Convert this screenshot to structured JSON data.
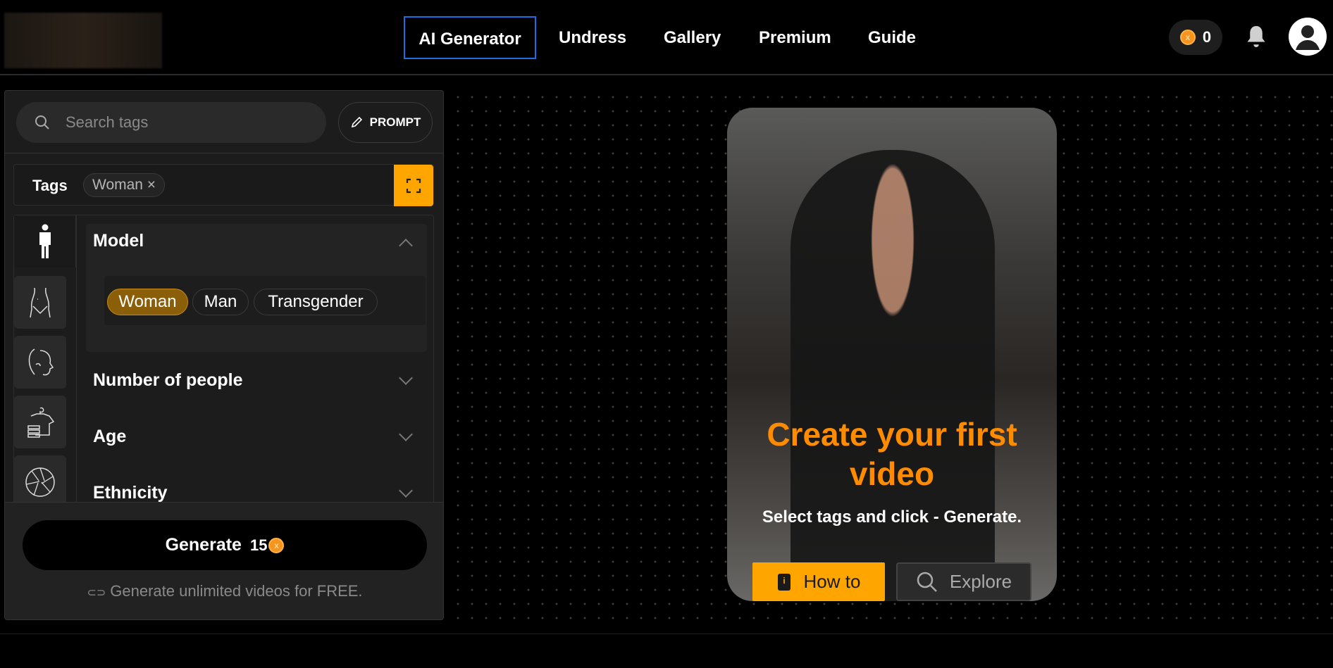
{
  "header": {
    "nav": [
      {
        "label": "AI Generator",
        "active": true
      },
      {
        "label": "Undress"
      },
      {
        "label": "Gallery"
      },
      {
        "label": "Premium"
      },
      {
        "label": "Guide"
      }
    ],
    "coins": "0",
    "icons": {
      "coin": "coin-icon",
      "bell": "bell-icon",
      "avatar": "user-avatar-icon"
    }
  },
  "panel": {
    "search": {
      "placeholder": "Search tags"
    },
    "prompt_label": "PROMPT",
    "tags_label": "Tags",
    "selected_tags": [
      {
        "label": "Woman ×"
      }
    ],
    "accent": "#ffa500",
    "sections": [
      {
        "title": "Model",
        "expanded": true,
        "options": [
          {
            "label": "Woman",
            "selected": true
          },
          {
            "label": "Man"
          },
          {
            "label": "Transgender"
          }
        ]
      },
      {
        "title": "Number of people",
        "expanded": false
      },
      {
        "title": "Age",
        "expanded": false
      },
      {
        "title": "Ethnicity",
        "expanded": false
      }
    ],
    "generate": {
      "label": "Generate",
      "cost": "15",
      "coin_symbol": "x"
    },
    "free_text": "Generate unlimited videos for FREE."
  },
  "card": {
    "title": "Create your first video",
    "subtitle": "Select tags and click - Generate.",
    "howto_label": "How to",
    "explore_label": "Explore",
    "title_color": "#ff8c00"
  }
}
